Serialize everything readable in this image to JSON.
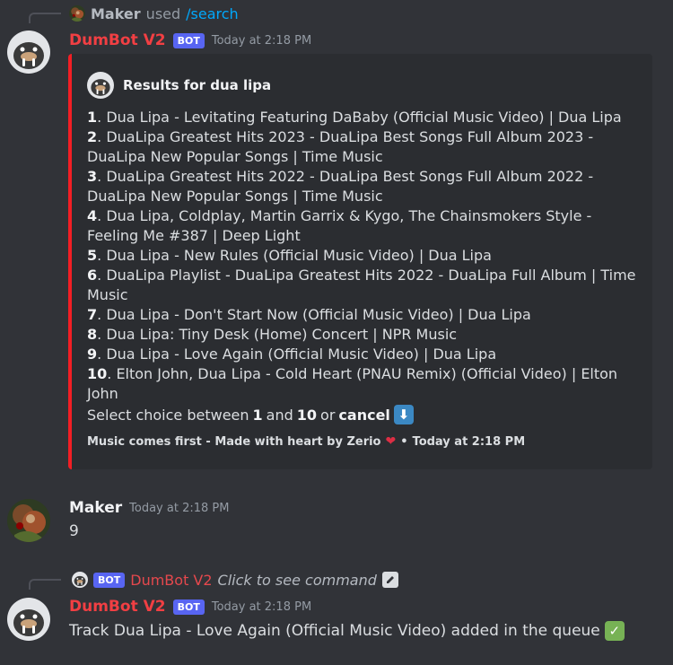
{
  "interaction1": {
    "user": "Maker",
    "used": "used",
    "command": "/search"
  },
  "message1": {
    "username": "DumBot V2",
    "bot_tag": "BOT",
    "timestamp": "Today at 2:18 PM",
    "embed": {
      "accent_color": "#f21e24",
      "author": "Results for dua lipa",
      "results": [
        {
          "n": "1",
          "text": ". Dua Lipa - Levitating Featuring DaBaby (Official Music Video) | Dua Lipa"
        },
        {
          "n": "2",
          "text": ". DuaLipa Greatest Hits 2023 - DuaLipa Best Songs Full Album 2023 - DuaLipa New Popular Songs | Time Music"
        },
        {
          "n": "3",
          "text": ". DuaLipa Greatest Hits 2022 - DuaLipa Best Songs Full Album 2022 - DuaLipa New Popular Songs | Time Music"
        },
        {
          "n": "4",
          "text": ". Dua Lipa, Coldplay, Martin Garrix & Kygo, The Chainsmokers Style - Feeling Me #387 | Deep Light"
        },
        {
          "n": "5",
          "text": ". Dua Lipa - New Rules (Official Music Video) | Dua Lipa"
        },
        {
          "n": "6",
          "text": ". DuaLipa Playlist - DuaLipa Greatest Hits 2022 - DuaLipa Full Album | Time Music"
        },
        {
          "n": "7",
          "text": ". Dua Lipa - Don't Start Now (Official Music Video) | Dua Lipa"
        },
        {
          "n": "8",
          "text": ". Dua Lipa: Tiny Desk (Home) Concert | NPR Music"
        },
        {
          "n": "9",
          "text": ". Dua Lipa - Love Again (Official Music Video) | Dua Lipa"
        },
        {
          "n": "10",
          "text": ". Elton John, Dua Lipa - Cold Heart (PNAU Remix) (Official Video) | Elton John"
        }
      ],
      "prompt": {
        "prefix": "Select choice between",
        "min": "1",
        "and": "and",
        "max": "10",
        "or": "or",
        "cancel": "cancel",
        "emoji": "down-arrow-emoji"
      },
      "footer": {
        "text": "Music comes first - Made with heart by Zerio",
        "separator": "•",
        "timestamp": "Today at 2:18 PM"
      }
    }
  },
  "message2": {
    "username": "Maker",
    "timestamp": "Today at 2:18 PM",
    "content": "9"
  },
  "interaction2": {
    "bot_tag": "BOT",
    "bot_name": "DumBot V2",
    "text": "Click to see command"
  },
  "message3": {
    "username": "DumBot V2",
    "bot_tag": "BOT",
    "timestamp": "Today at 2:18 PM",
    "content": "Track Dua Lipa - Love Again (Official Music Video) added in the queue",
    "emoji": "check-mark-emoji"
  },
  "colors": {
    "background": "#313338",
    "embed_background": "#2b2d31",
    "bot_name": "#f23f43",
    "bot_tag": "#5865f2",
    "link": "#00a8fc"
  }
}
